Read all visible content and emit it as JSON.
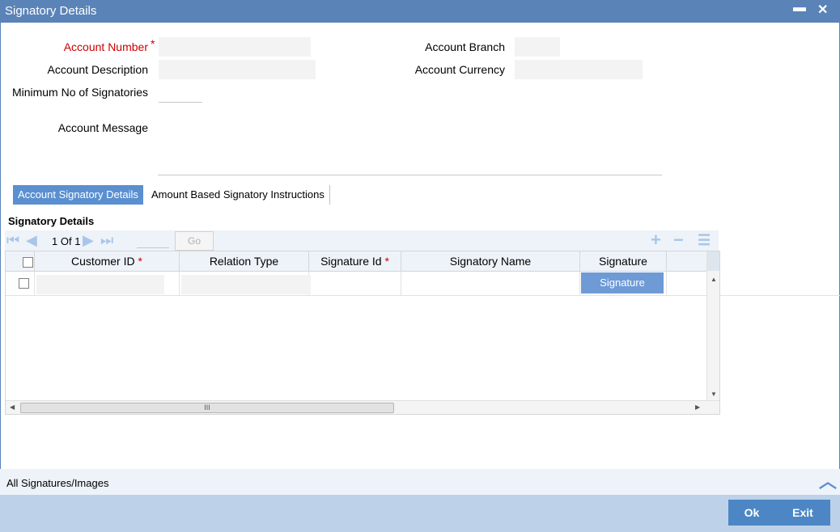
{
  "window": {
    "title": "Signatory Details",
    "minimize_glyph": "▬",
    "close_glyph": "✕"
  },
  "form": {
    "account_number_label": "Account Number",
    "required_mark": "*",
    "account_description_label": "Account Description",
    "min_signatories_label": "Minimum No of Signatories",
    "account_message_label": "Account Message",
    "account_branch_label": "Account Branch",
    "account_currency_label": "Account Currency"
  },
  "tabs": [
    {
      "label": "Account Signatory Details",
      "active": true
    },
    {
      "label": "Amount Based Signatory Instructions",
      "active": false
    }
  ],
  "section": {
    "title": "Signatory Details"
  },
  "pager": {
    "current": "1",
    "of_label": "Of",
    "total": "1",
    "go_label": "Go"
  },
  "grid": {
    "columns": [
      {
        "label": "Customer ID",
        "required": true
      },
      {
        "label": "Relation Type",
        "required": false
      },
      {
        "label": "Signature Id",
        "required": true
      },
      {
        "label": "Signatory Name",
        "required": false
      },
      {
        "label": "Signature",
        "required": false
      }
    ],
    "required_mark": "*",
    "row_button_label": "Signature",
    "hscroll_grip": "III"
  },
  "bottom": {
    "all_signatures_label": "All Signatures/Images",
    "ok_label": "Ok",
    "exit_label": "Exit"
  },
  "colors": {
    "titlebar": "#5a83b8",
    "accent": "#5a8fd0",
    "footer": "#bdd2e8",
    "required": "#cc0000"
  }
}
